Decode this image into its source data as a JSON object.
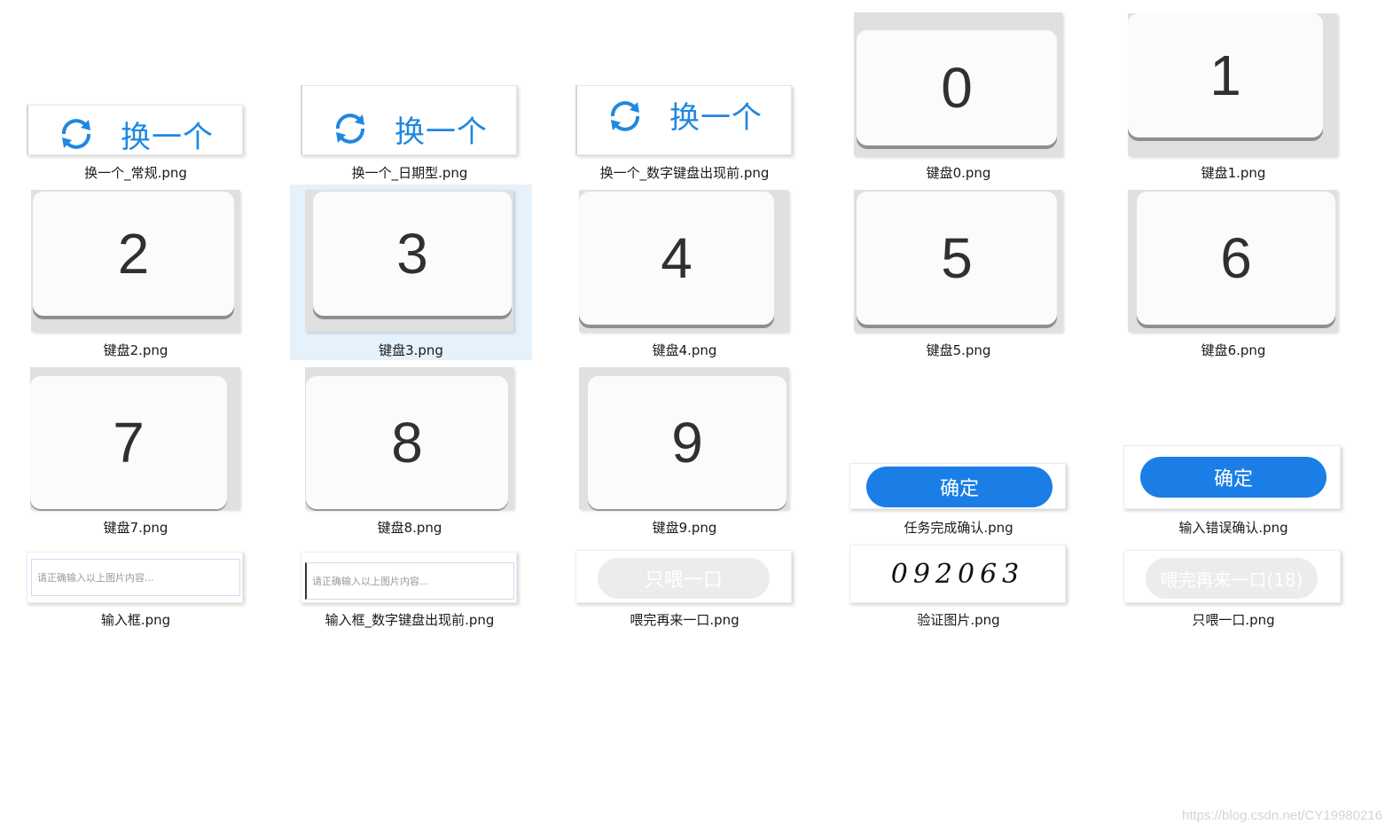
{
  "files": [
    {
      "name": "换一个_常规.png",
      "kind": "refresh",
      "label": "换一个"
    },
    {
      "name": "换一个_日期型.png",
      "kind": "refresh",
      "label": "换一个"
    },
    {
      "name": "换一个_数字键盘出现前.png",
      "kind": "refresh",
      "label": "换一个"
    },
    {
      "name": "键盘0.png",
      "kind": "key",
      "label": "0"
    },
    {
      "name": "键盘1.png",
      "kind": "key",
      "label": "1"
    },
    {
      "name": "键盘2.png",
      "kind": "key",
      "label": "2"
    },
    {
      "name": "键盘3.png",
      "kind": "key",
      "label": "3",
      "selected": true
    },
    {
      "name": "键盘4.png",
      "kind": "key",
      "label": "4"
    },
    {
      "name": "键盘5.png",
      "kind": "key",
      "label": "5"
    },
    {
      "name": "键盘6.png",
      "kind": "key",
      "label": "6"
    },
    {
      "name": "键盘7.png",
      "kind": "key",
      "label": "7"
    },
    {
      "name": "键盘8.png",
      "kind": "key",
      "label": "8"
    },
    {
      "name": "键盘9.png",
      "kind": "key",
      "label": "9"
    },
    {
      "name": "任务完成确认.png",
      "kind": "confirm",
      "label": "确定"
    },
    {
      "name": "输入错误确认.png",
      "kind": "confirm",
      "label": "确定"
    },
    {
      "name": "输入框.png",
      "kind": "input",
      "label": "请正确输入以上图片内容..."
    },
    {
      "name": "输入框_数字键盘出现前.png",
      "kind": "input",
      "label": "请正确输入以上图片内容..."
    },
    {
      "name": "喂完再来一口.png",
      "kind": "pill",
      "label": "只喂一口"
    },
    {
      "name": "验证图片.png",
      "kind": "captcha",
      "label": "092063"
    },
    {
      "name": "只喂一口.png",
      "kind": "pill",
      "label": "喂完再来一口(18)"
    }
  ],
  "watermark": "https://blog.csdn.net/CY19980216",
  "colors": {
    "accent": "#1f88e0",
    "button": "#1a7ee6",
    "selection": "#e5f1fb"
  }
}
